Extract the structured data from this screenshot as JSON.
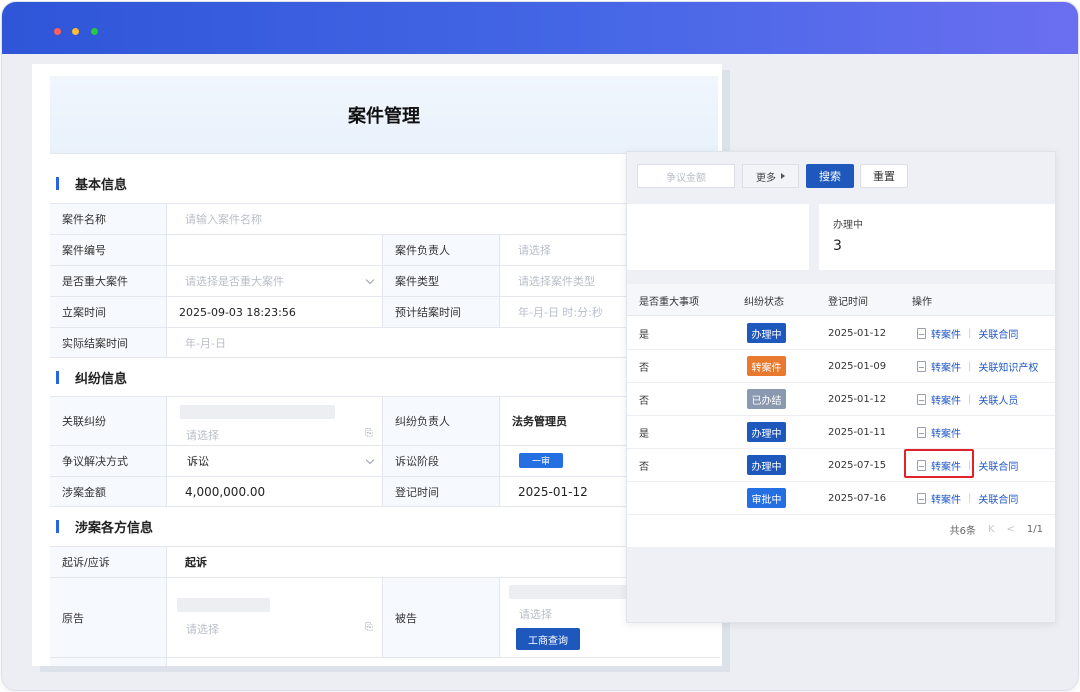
{
  "form": {
    "title": "案件管理",
    "sections": {
      "basic": "基本信息",
      "dispute": "纠纷信息",
      "parties": "涉案各方信息"
    },
    "basic": {
      "case_name_label": "案件名称",
      "case_name_placeholder": "请输入案件名称",
      "case_no_label": "案件编号",
      "owner_label": "案件负责人",
      "owner_placeholder": "请选择",
      "major_label": "是否重大案件",
      "major_placeholder": "请选择是否重大案件",
      "type_label": "案件类型",
      "type_placeholder": "请选择案件类型",
      "filed_label": "立案时间",
      "filed_value": "2025-09-03 18:23:56",
      "expected_label": "预计结案时间",
      "expected_placeholder": "年-月-日 时:分:秒",
      "closed_label": "实际结案时间",
      "closed_placeholder": "年-月-日"
    },
    "dispute": {
      "related_label": "关联纠纷",
      "related_placeholder": "请选择",
      "dispute_owner_label": "纠纷负责人",
      "dispute_owner_value": "法务管理员",
      "resolution_label": "争议解决方式",
      "resolution_value": "诉讼",
      "stage_label": "诉讼阶段",
      "stage_value": "一审",
      "amount_label": "涉案金额",
      "amount_value": "4,000,000.00",
      "reg_label": "登记时间",
      "reg_value": "2025-01-12"
    },
    "parties": {
      "role_label": "起诉/应诉",
      "role_value": "起诉",
      "plaintiff_label": "原告",
      "plaintiff_placeholder": "请选择",
      "defendant_label": "被告",
      "defendant_placeholder": "请选择",
      "biz_query_btn": "工商查询"
    }
  },
  "list": {
    "toolbar": {
      "amount_placeholder": "争议金额",
      "more": "更多",
      "search": "搜索",
      "reset": "重置"
    },
    "stat": {
      "label": "办理中",
      "value": "3"
    },
    "columns": [
      "是否重大事项",
      "纠纷状态",
      "登记时间",
      "操作"
    ],
    "rows": [
      {
        "major": "是",
        "status": "办理中",
        "date": "2025-01-12",
        "op1": "转案件",
        "op2": "关联合同"
      },
      {
        "major": "否",
        "status": "转案件",
        "date": "2025-01-09",
        "op1": "转案件",
        "op2": "关联知识产权"
      },
      {
        "major": "否",
        "status": "已办结",
        "date": "2025-01-12",
        "op1": "转案件",
        "op2": "关联人员"
      },
      {
        "major": "是",
        "status": "办理中",
        "date": "2025-01-11",
        "op1": "转案件",
        "op2": ""
      },
      {
        "major": "否",
        "status": "办理中",
        "date": "2025-07-15",
        "op1": "转案件",
        "op2": "关联合同"
      },
      {
        "major": "",
        "status": "审批中",
        "date": "2025-07-16",
        "op1": "转案件",
        "op2": "关联合同"
      }
    ],
    "status_colors": {
      "办理中": "#1f58bd",
      "转案件": "#e8792d",
      "已办结": "#8a99b0",
      "审批中": "#2470e3"
    },
    "pager": {
      "total": "共6条",
      "first": "K",
      "prev": "<",
      "page": "1/1"
    }
  }
}
